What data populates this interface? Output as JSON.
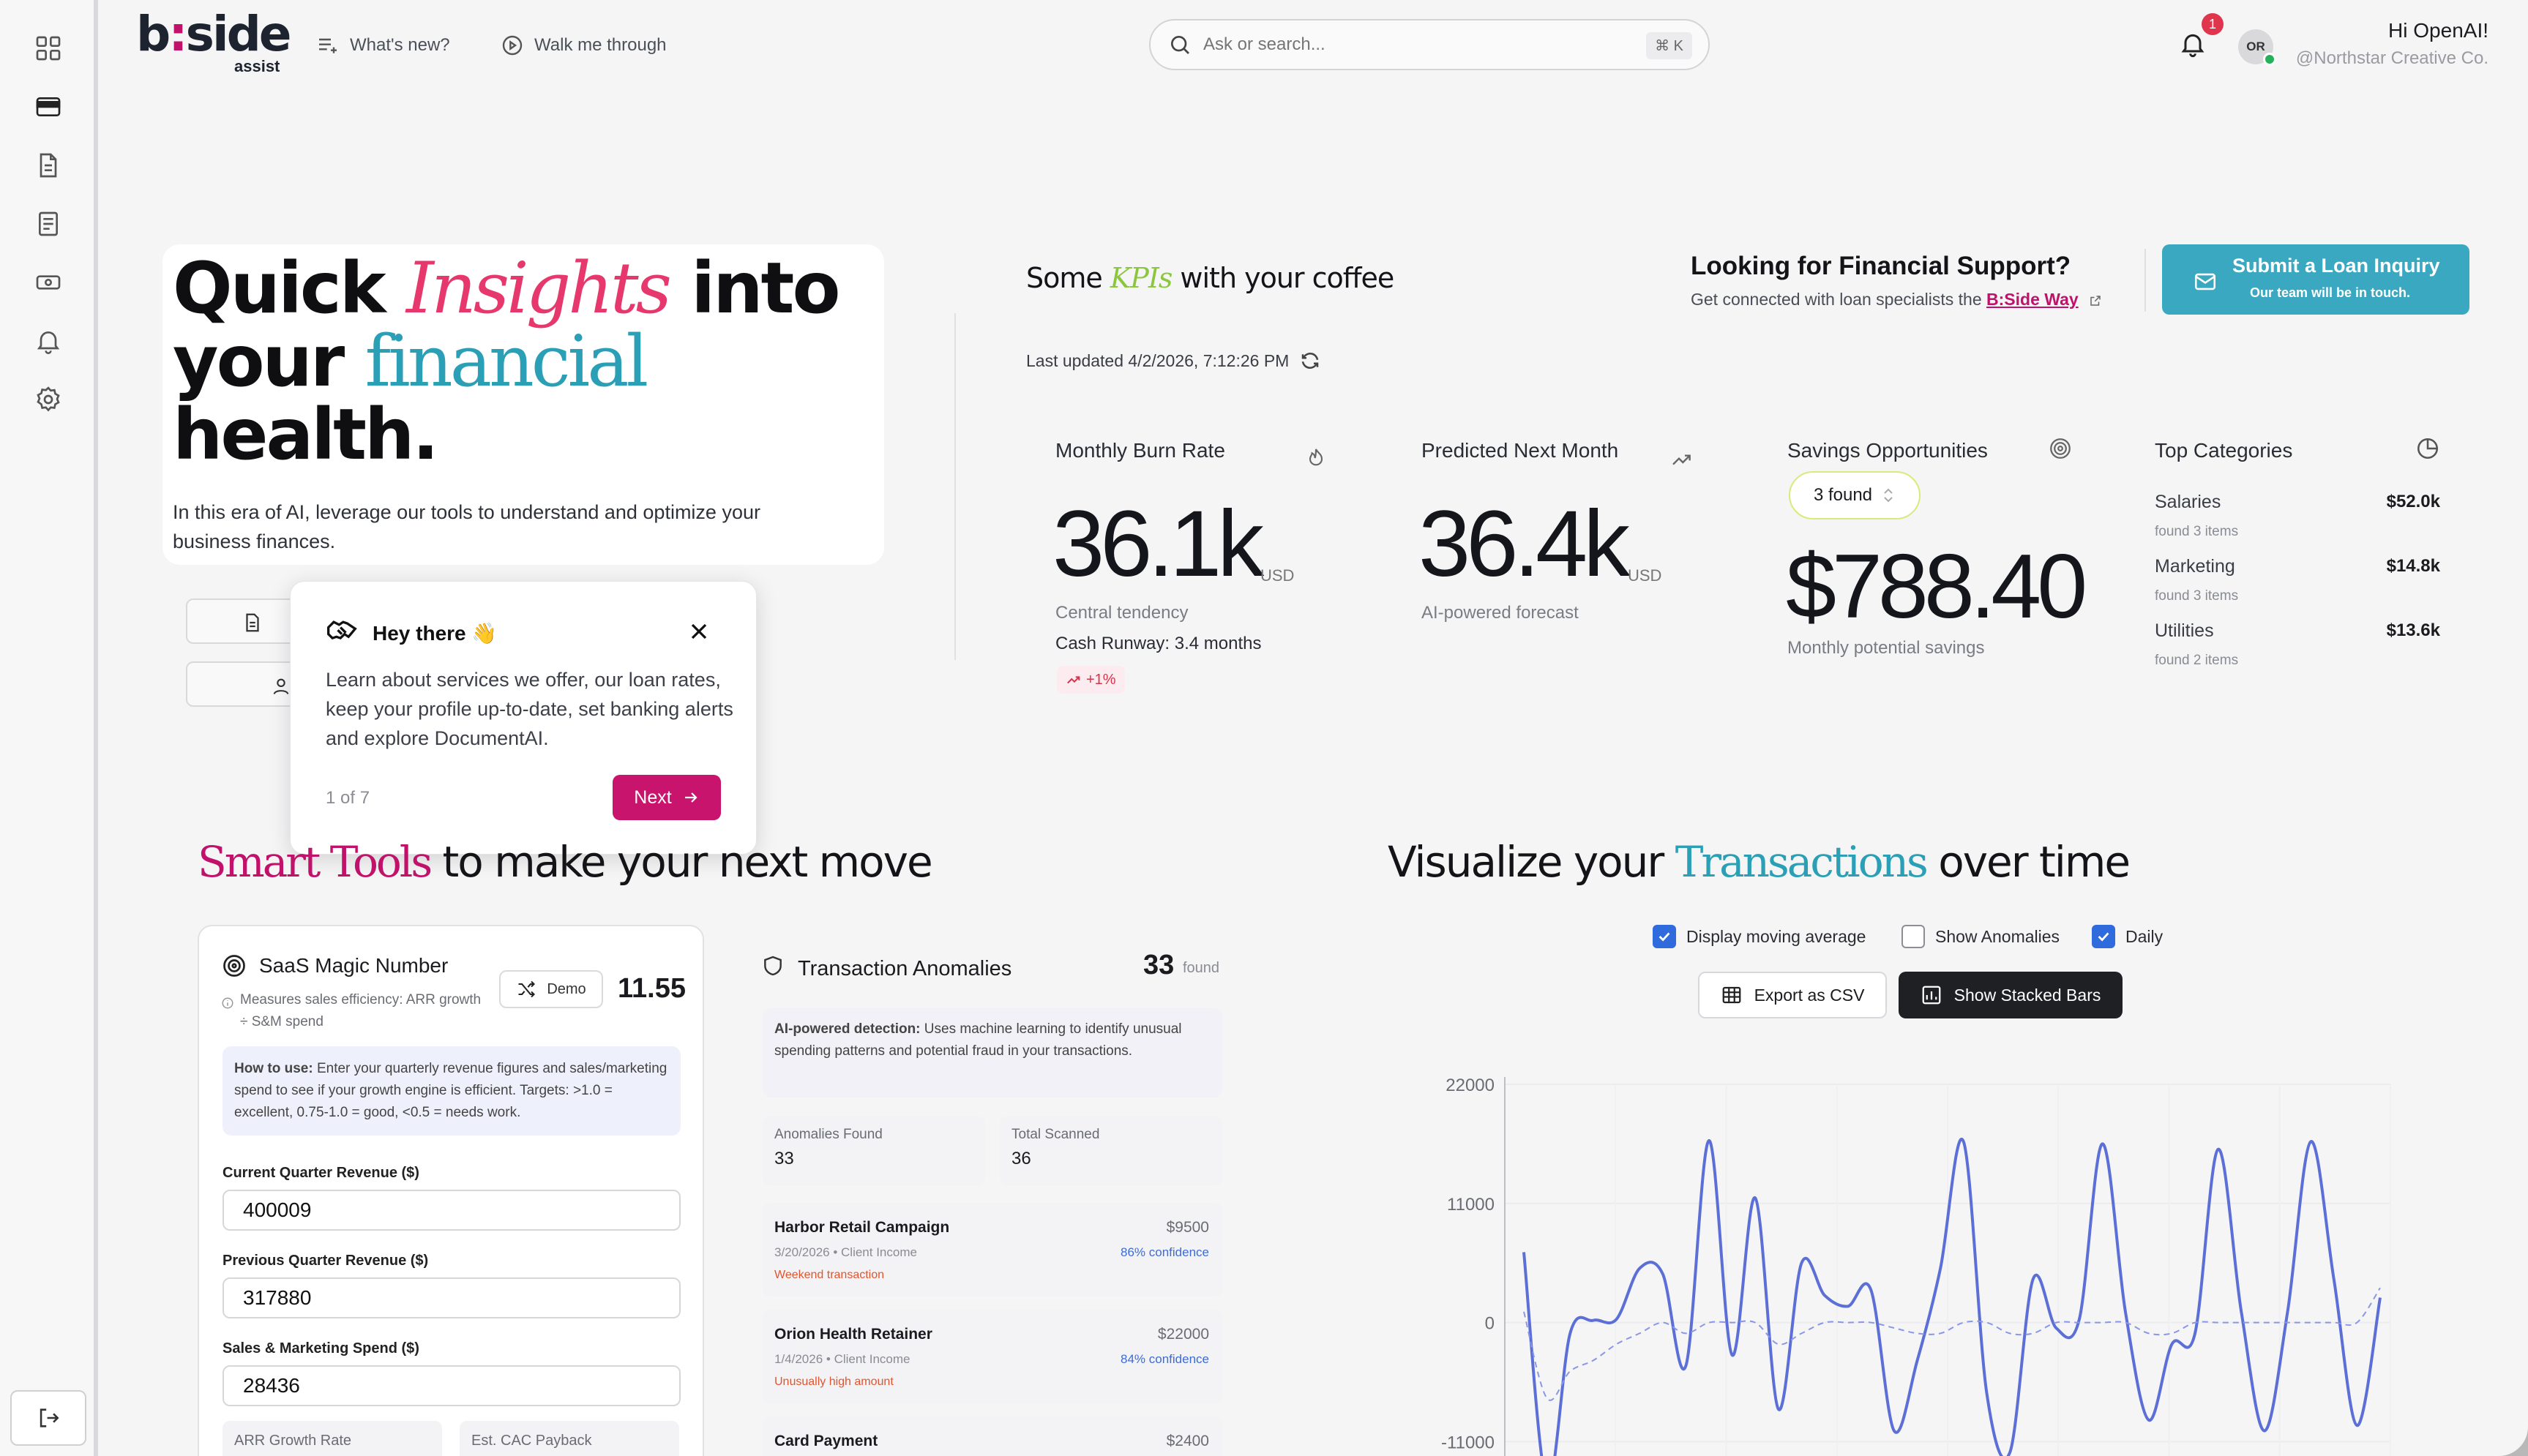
{
  "brand": {
    "logo_main": "b:side",
    "logo_sub": "assist"
  },
  "topbar": {
    "whats_new": "What's new?",
    "walk_me": "Walk me through",
    "search_placeholder": "Ask or search...",
    "search_shortcut": "⌘ K",
    "notif_count": "1",
    "avatar_initials": "OR",
    "greeting": "Hi OpenAI!",
    "org": "@Northstar Creative Co."
  },
  "sidebar": {
    "items": [
      "dashboard-icon",
      "card-icon",
      "document-icon",
      "report-icon",
      "cash-icon",
      "bell-icon",
      "settings-icon"
    ],
    "logout": "logout-icon"
  },
  "hero": {
    "line1_a": "Quick ",
    "line1_b": "Insights",
    "line1_c": " into",
    "line2_a": "your ",
    "line2_b": "financial",
    "line3": "health.",
    "body": "In this era of AI, leverage our tools to understand and optimize your business finances."
  },
  "tour": {
    "title": "Hey there 👋",
    "body": "Learn about services we offer, our loan rates, keep your profile up-to-date, set banking alerts and explore DocumentAI.",
    "counter": "1 of 7",
    "next": "Next"
  },
  "kpis": {
    "title_a": "Some ",
    "title_b": "KPIs",
    "title_c": " with your coffee",
    "updated": "Last updated 4/2/2026, 7:12:26 PM",
    "burn": {
      "title": "Monthly Burn Rate",
      "value": "36.1k",
      "unit": "USD",
      "note": "Central tendency",
      "runway": "Cash Runway: 3.4 months",
      "delta": "+1%"
    },
    "predicted": {
      "title": "Predicted Next Month",
      "value": "36.4k",
      "unit": "USD",
      "note": "AI-powered forecast"
    },
    "savings": {
      "title": "Savings Opportunities",
      "found": "3 found",
      "value": "$788.40",
      "note": "Monthly potential savings"
    },
    "categories": {
      "title": "Top Categories",
      "items": [
        {
          "name": "Salaries",
          "value": "$52.0k",
          "count": "found 3 items"
        },
        {
          "name": "Marketing",
          "value": "$14.8k",
          "count": "found 3 items"
        },
        {
          "name": "Utilities",
          "value": "$13.6k",
          "count": "found 2 items"
        }
      ]
    }
  },
  "loan": {
    "title": "Looking for Financial Support?",
    "subtitle": "Get connected with loan specialists the ",
    "link": "B:Side Way",
    "button": "Submit a Loan Inquiry",
    "button_sub": "Our team will be in touch."
  },
  "smart": {
    "title_a": "Smart Tools",
    "title_b": " to make your next move",
    "saas": {
      "title": "SaaS Magic Number",
      "desc": "Measures sales efficiency: ARR growth ÷ S&M spend",
      "demo": "Demo",
      "value": "11.55",
      "howto_label": "How to use:",
      "howto": " Enter your quarterly revenue figures and sales/marketing spend to see if your growth engine is efficient. Targets: >1.0 = excellent, 0.75-1.0 = good, <0.5 = needs work.",
      "f1_label": "Current Quarter Revenue ($)",
      "f1_value": "400009",
      "f2_label": "Previous Quarter Revenue ($)",
      "f2_value": "317880",
      "f3_label": "Sales & Marketing Spend ($)",
      "f3_value": "28436",
      "m1": "ARR Growth Rate",
      "m2": "Est. CAC Payback"
    },
    "anomalies": {
      "title": "Transaction Anomalies",
      "count": "33",
      "found": "found",
      "ai_label": "AI-powered detection:",
      "ai_text": " Uses machine learning to identify unusual spending patterns and potential fraud in your transactions.",
      "stat1_label": "Anomalies Found",
      "stat1_value": "33",
      "stat2_label": "Total Scanned",
      "stat2_value": "36",
      "rows": [
        {
          "name": "Harbor Retail Campaign",
          "amount": "$9500",
          "meta": "3/20/2026 • Client Income",
          "conf": "86% confidence",
          "reason": "Weekend transaction"
        },
        {
          "name": "Orion Health Retainer",
          "amount": "$22000",
          "meta": "1/4/2026 • Client Income",
          "conf": "84% confidence",
          "reason": "Unusually high amount"
        },
        {
          "name": "Card Payment",
          "amount": "$2400"
        }
      ]
    }
  },
  "viz": {
    "title_a": "Visualize your ",
    "title_b": "Transactions",
    "title_c": " over time",
    "cb1": "Display moving average",
    "cb2": "Show Anomalies",
    "cb3": "Daily",
    "export": "Export as CSV",
    "stacked": "Show Stacked Bars"
  },
  "chart_data": {
    "type": "line",
    "ylim": [
      -13000,
      22000
    ],
    "y_ticks": [
      22000,
      11000,
      0,
      -11000
    ],
    "grid": true,
    "series": [
      {
        "values": [
          6500,
          -15000,
          -1000,
          200,
          300,
          5000,
          4500,
          -4000,
          16800,
          -3000,
          11500,
          -8000,
          5500,
          2500,
          1500,
          3000,
          -10000,
          -3500,
          5000,
          16700,
          -6500,
          -12000,
          4000,
          -500,
          300,
          16500,
          900,
          -9000,
          -2000,
          -1000,
          16000,
          1000,
          -10000,
          1000,
          16700,
          4000,
          -9500,
          2300
        ],
        "color": "#5b6fd6"
      },
      {
        "values": [
          1000,
          -7000,
          -4500,
          -3500,
          -2000,
          -1000,
          0,
          -1000,
          0,
          0,
          0,
          -2000,
          -1000,
          0,
          0,
          0,
          -500,
          -1000,
          -1000,
          0,
          0,
          -1000,
          -1000,
          0,
          0,
          0,
          0,
          -1000,
          -1000,
          0,
          0,
          0,
          0,
          0,
          0,
          0,
          0,
          3200
        ],
        "color": "#8a97e6",
        "dashed": true
      }
    ]
  }
}
